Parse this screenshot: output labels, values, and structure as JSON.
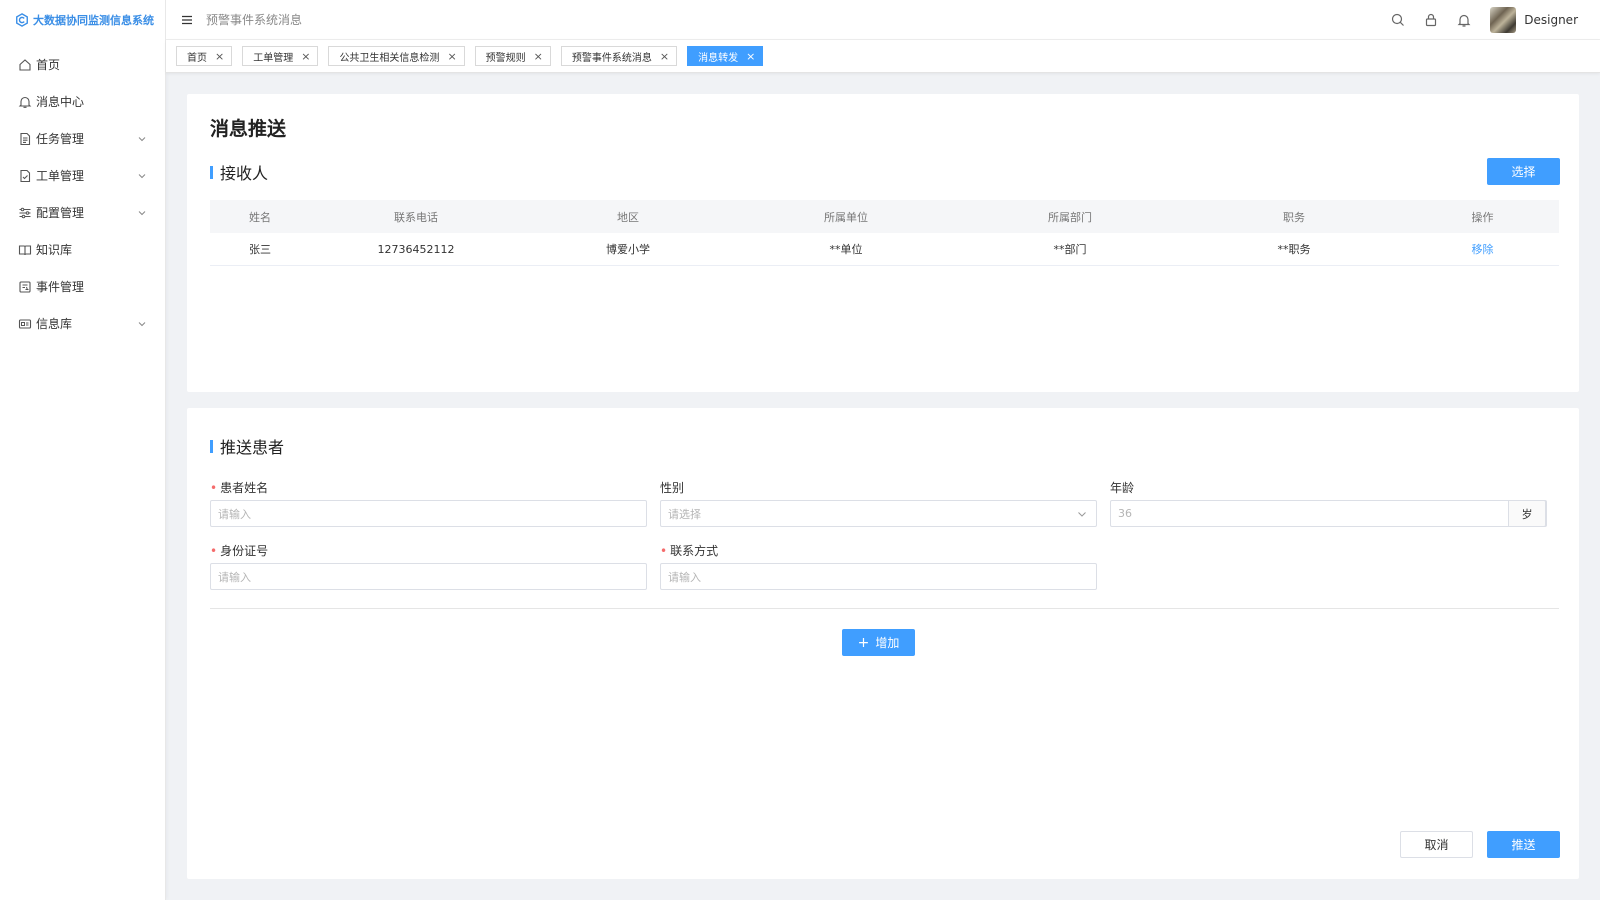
{
  "app": {
    "title": "大数据协同监测信息系统"
  },
  "sidebar": {
    "items": [
      {
        "label": "首页",
        "icon": "home-icon"
      },
      {
        "label": "消息中心",
        "icon": "bell-icon"
      },
      {
        "label": "任务管理",
        "icon": "document-icon",
        "expandable": true
      },
      {
        "label": "工单管理",
        "icon": "ticket-icon",
        "expandable": true
      },
      {
        "label": "配置管理",
        "icon": "sliders-icon",
        "expandable": true
      },
      {
        "label": "知识库",
        "icon": "book-icon"
      },
      {
        "label": "事件管理",
        "icon": "event-icon"
      },
      {
        "label": "信息库",
        "icon": "database-icon",
        "expandable": true
      }
    ]
  },
  "header": {
    "breadcrumb": "预警事件系统消息",
    "username": "Designer"
  },
  "tabs": [
    {
      "label": "首页",
      "active": false
    },
    {
      "label": "工单管理",
      "active": false
    },
    {
      "label": "公共卫生相关信息检测",
      "active": false
    },
    {
      "label": "预警规则",
      "active": false
    },
    {
      "label": "预警事件系统消息",
      "active": false
    },
    {
      "label": "消息转发",
      "active": true
    }
  ],
  "page": {
    "title": "消息推送"
  },
  "recipients": {
    "title": "接收人",
    "select_label": "选择",
    "columns": [
      "姓名",
      "联系电话",
      "地区",
      "所属单位",
      "所属部门",
      "职务",
      "操作"
    ],
    "rows": [
      {
        "name": "张三",
        "phone": "12736452112",
        "region": "博爱小学",
        "unit": "**单位",
        "dept": "**部门",
        "position": "**职务",
        "action": "移除"
      }
    ]
  },
  "patient": {
    "title": "推送患者",
    "name_label": "患者姓名",
    "name_placeholder": "请输入",
    "gender_label": "性别",
    "gender_placeholder": "请选择",
    "age_label": "年龄",
    "age_placeholder": "36",
    "age_unit": "岁",
    "id_label": "身份证号",
    "id_placeholder": "请输入",
    "contact_label": "联系方式",
    "contact_placeholder": "请输入",
    "add_label": "增加"
  },
  "footer": {
    "cancel_label": "取消",
    "submit_label": "推送"
  },
  "colors": {
    "primary": "#409eff",
    "danger": "#f56c6c"
  }
}
